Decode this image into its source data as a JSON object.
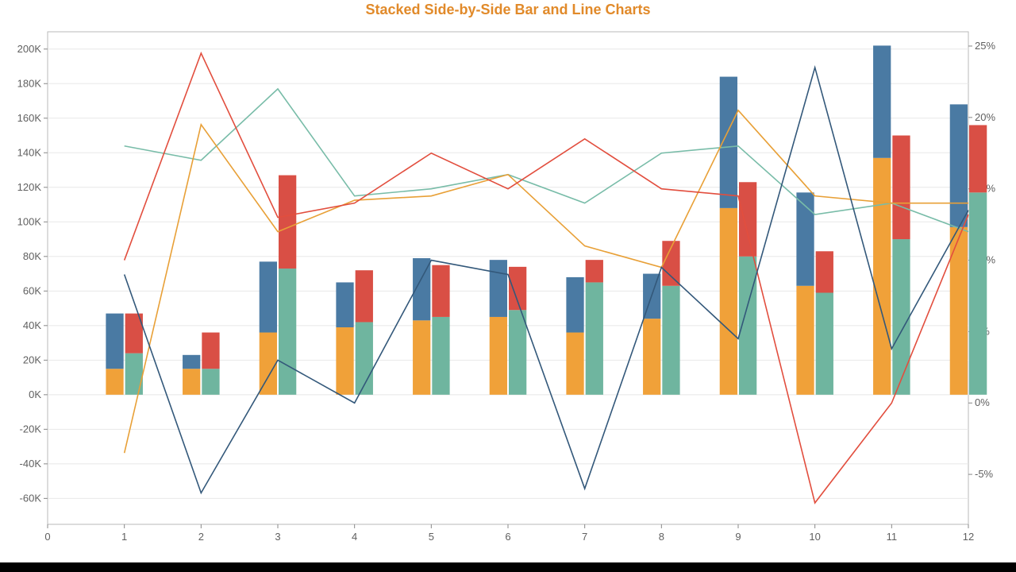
{
  "title": "Stacked Side-by-Side Bar and Line Charts",
  "colors": {
    "navy": "#4a7aa3",
    "orange": "#f0a139",
    "red": "#d94f45",
    "teal": "#6fb59f",
    "line_navy": "#33587a",
    "line_orange": "#e8a037",
    "line_red": "#e24e3e",
    "line_teal": "#78bca8",
    "axis": "#606060"
  },
  "chart_data": {
    "type": "bar",
    "title": "Stacked Side-by-Side Bar and Line Charts",
    "xlabel": "",
    "ylabel_left": "",
    "ylabel_right": "",
    "x_ticks": [
      0,
      1,
      2,
      3,
      4,
      5,
      6,
      7,
      8,
      9,
      10,
      11,
      12
    ],
    "y_left_ticks": [
      -60000,
      -40000,
      -20000,
      0,
      20000,
      40000,
      60000,
      80000,
      100000,
      120000,
      140000,
      160000,
      180000,
      200000
    ],
    "y_left_tick_labels": [
      "-60K",
      "-40K",
      "-20K",
      "0K",
      "20K",
      "40K",
      "60K",
      "80K",
      "100K",
      "120K",
      "140K",
      "160K",
      "180K",
      "200K"
    ],
    "y_right_ticks": [
      -5,
      0,
      5,
      10,
      15,
      20,
      25
    ],
    "y_right_tick_labels": [
      "-5%",
      "0%",
      "5%",
      "10%",
      "15%",
      "20%",
      "25%"
    ],
    "ylim_left": [
      -75000,
      210000
    ],
    "ylim_right": [
      -8.5,
      26
    ],
    "categories": [
      1,
      2,
      3,
      4,
      5,
      6,
      7,
      8,
      9,
      10,
      11,
      12
    ],
    "bars": {
      "note": "Two stacked bars per category. bar A = orange(bottom)+navy(top); bar B = teal(bottom)+red(top). Values are the height of each segment (K).",
      "A_orange": [
        15,
        15,
        36,
        39,
        43,
        45,
        36,
        44,
        108,
        63,
        137,
        97
      ],
      "A_navy": [
        32,
        8,
        41,
        26,
        36,
        33,
        32,
        26,
        76,
        54,
        65,
        71
      ],
      "B_teal": [
        24,
        15,
        73,
        42,
        45,
        49,
        65,
        63,
        80,
        59,
        90,
        117
      ],
      "B_red": [
        23,
        21,
        54,
        30,
        30,
        25,
        13,
        26,
        43,
        24,
        60,
        39
      ]
    },
    "lines_pct": {
      "note": "Values are percentages on the right axis.",
      "navy": [
        9.0,
        -6.3,
        3.0,
        0.0,
        10.0,
        9.0,
        -6.0,
        9.5,
        4.5,
        23.5,
        3.8,
        13.5
      ],
      "orange": [
        -3.5,
        19.5,
        12.0,
        14.2,
        14.5,
        16.0,
        11.0,
        9.5,
        20.5,
        14.5,
        14.0,
        14.0
      ],
      "red": [
        10.0,
        24.5,
        13.0,
        14.0,
        17.5,
        15.0,
        18.5,
        15.0,
        14.5,
        -7.0,
        0.0,
        13.2
      ],
      "teal": [
        18.0,
        17.0,
        22.0,
        14.5,
        15.0,
        16.0,
        14.0,
        17.5,
        18.0,
        13.2,
        14.0,
        12.0
      ]
    }
  }
}
